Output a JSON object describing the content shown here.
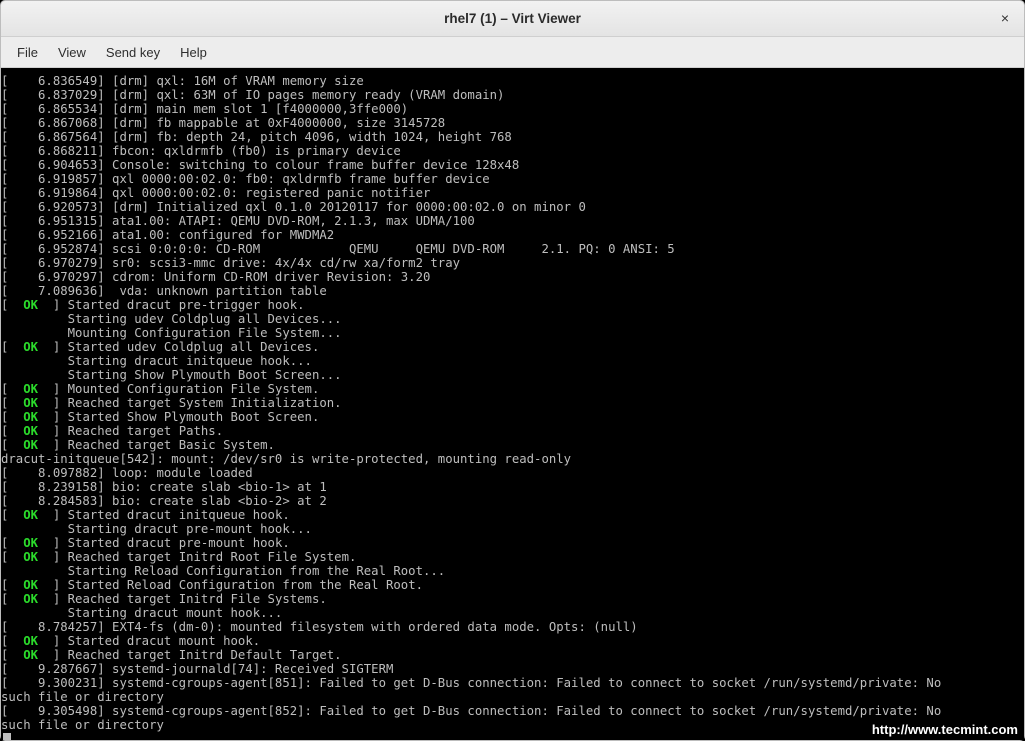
{
  "window": {
    "title": "rhel7 (1) – Virt Viewer",
    "close_label": "×"
  },
  "menu": {
    "file": "File",
    "view": "View",
    "sendkey": "Send key",
    "help": "Help"
  },
  "ok_token": "OK",
  "lines": [
    {
      "t": "plain",
      "text": "[    6.836549] [drm] qxl: 16M of VRAM memory size"
    },
    {
      "t": "plain",
      "text": "[    6.837029] [drm] qxl: 63M of IO pages memory ready (VRAM domain)"
    },
    {
      "t": "plain",
      "text": "[    6.865534] [drm] main mem slot 1 [f4000000,3ffe000)"
    },
    {
      "t": "plain",
      "text": "[    6.867068] [drm] fb mappable at 0xF4000000, size 3145728"
    },
    {
      "t": "plain",
      "text": "[    6.867564] [drm] fb: depth 24, pitch 4096, width 1024, height 768"
    },
    {
      "t": "plain",
      "text": "[    6.868211] fbcon: qxldrmfb (fb0) is primary device"
    },
    {
      "t": "plain",
      "text": "[    6.904653] Console: switching to colour frame buffer device 128x48"
    },
    {
      "t": "plain",
      "text": "[    6.919857] qxl 0000:00:02.0: fb0: qxldrmfb frame buffer device"
    },
    {
      "t": "plain",
      "text": "[    6.919864] qxl 0000:00:02.0: registered panic notifier"
    },
    {
      "t": "plain",
      "text": "[    6.920573] [drm] Initialized qxl 0.1.0 20120117 for 0000:00:02.0 on minor 0"
    },
    {
      "t": "plain",
      "text": "[    6.951315] ata1.00: ATAPI: QEMU DVD-ROM, 2.1.3, max UDMA/100"
    },
    {
      "t": "plain",
      "text": "[    6.952166] ata1.00: configured for MWDMA2"
    },
    {
      "t": "plain",
      "text": "[    6.952874] scsi 0:0:0:0: CD-ROM            QEMU     QEMU DVD-ROM     2.1. PQ: 0 ANSI: 5"
    },
    {
      "t": "plain",
      "text": "[    6.970279] sr0: scsi3-mmc drive: 4x/4x cd/rw xa/form2 tray"
    },
    {
      "t": "plain",
      "text": "[    6.970297] cdrom: Uniform CD-ROM driver Revision: 3.20"
    },
    {
      "t": "plain",
      "text": "[    7.089636]  vda: unknown partition table"
    },
    {
      "t": "ok",
      "text": "Started dracut pre-trigger hook."
    },
    {
      "t": "indent",
      "text": "Starting udev Coldplug all Devices..."
    },
    {
      "t": "indent",
      "text": "Mounting Configuration File System..."
    },
    {
      "t": "ok",
      "text": "Started udev Coldplug all Devices."
    },
    {
      "t": "indent",
      "text": "Starting dracut initqueue hook..."
    },
    {
      "t": "indent",
      "text": "Starting Show Plymouth Boot Screen..."
    },
    {
      "t": "ok",
      "text": "Mounted Configuration File System."
    },
    {
      "t": "ok",
      "text": "Reached target System Initialization."
    },
    {
      "t": "ok",
      "text": "Started Show Plymouth Boot Screen."
    },
    {
      "t": "ok",
      "text": "Reached target Paths."
    },
    {
      "t": "ok",
      "text": "Reached target Basic System."
    },
    {
      "t": "plain",
      "text": "dracut-initqueue[542]: mount: /dev/sr0 is write-protected, mounting read-only"
    },
    {
      "t": "plain",
      "text": "[    8.097882] loop: module loaded"
    },
    {
      "t": "plain",
      "text": "[    8.239158] bio: create slab <bio-1> at 1"
    },
    {
      "t": "plain",
      "text": "[    8.284583] bio: create slab <bio-2> at 2"
    },
    {
      "t": "ok",
      "text": "Started dracut initqueue hook."
    },
    {
      "t": "indent",
      "text": "Starting dracut pre-mount hook..."
    },
    {
      "t": "ok",
      "text": "Started dracut pre-mount hook."
    },
    {
      "t": "ok",
      "text": "Reached target Initrd Root File System."
    },
    {
      "t": "indent",
      "text": "Starting Reload Configuration from the Real Root..."
    },
    {
      "t": "ok",
      "text": "Started Reload Configuration from the Real Root."
    },
    {
      "t": "ok",
      "text": "Reached target Initrd File Systems."
    },
    {
      "t": "indent",
      "text": "Starting dracut mount hook..."
    },
    {
      "t": "plain",
      "text": "[    8.784257] EXT4-fs (dm-0): mounted filesystem with ordered data mode. Opts: (null)"
    },
    {
      "t": "ok",
      "text": "Started dracut mount hook."
    },
    {
      "t": "ok",
      "text": "Reached target Initrd Default Target."
    },
    {
      "t": "plain",
      "text": "[    9.287667] systemd-journald[74]: Received SIGTERM"
    },
    {
      "t": "plain",
      "text": "[    9.300231] systemd-cgroups-agent[851]: Failed to get D-Bus connection: Failed to connect to socket /run/systemd/private: No"
    },
    {
      "t": "plaincont",
      "text": "such file or directory"
    },
    {
      "t": "plain",
      "text": "[    9.305498] systemd-cgroups-agent[852]: Failed to get D-Bus connection: Failed to connect to socket /run/systemd/private: No"
    },
    {
      "t": "plaincont",
      "text": "such file or directory"
    }
  ],
  "watermark": "http://www.tecmint.com"
}
